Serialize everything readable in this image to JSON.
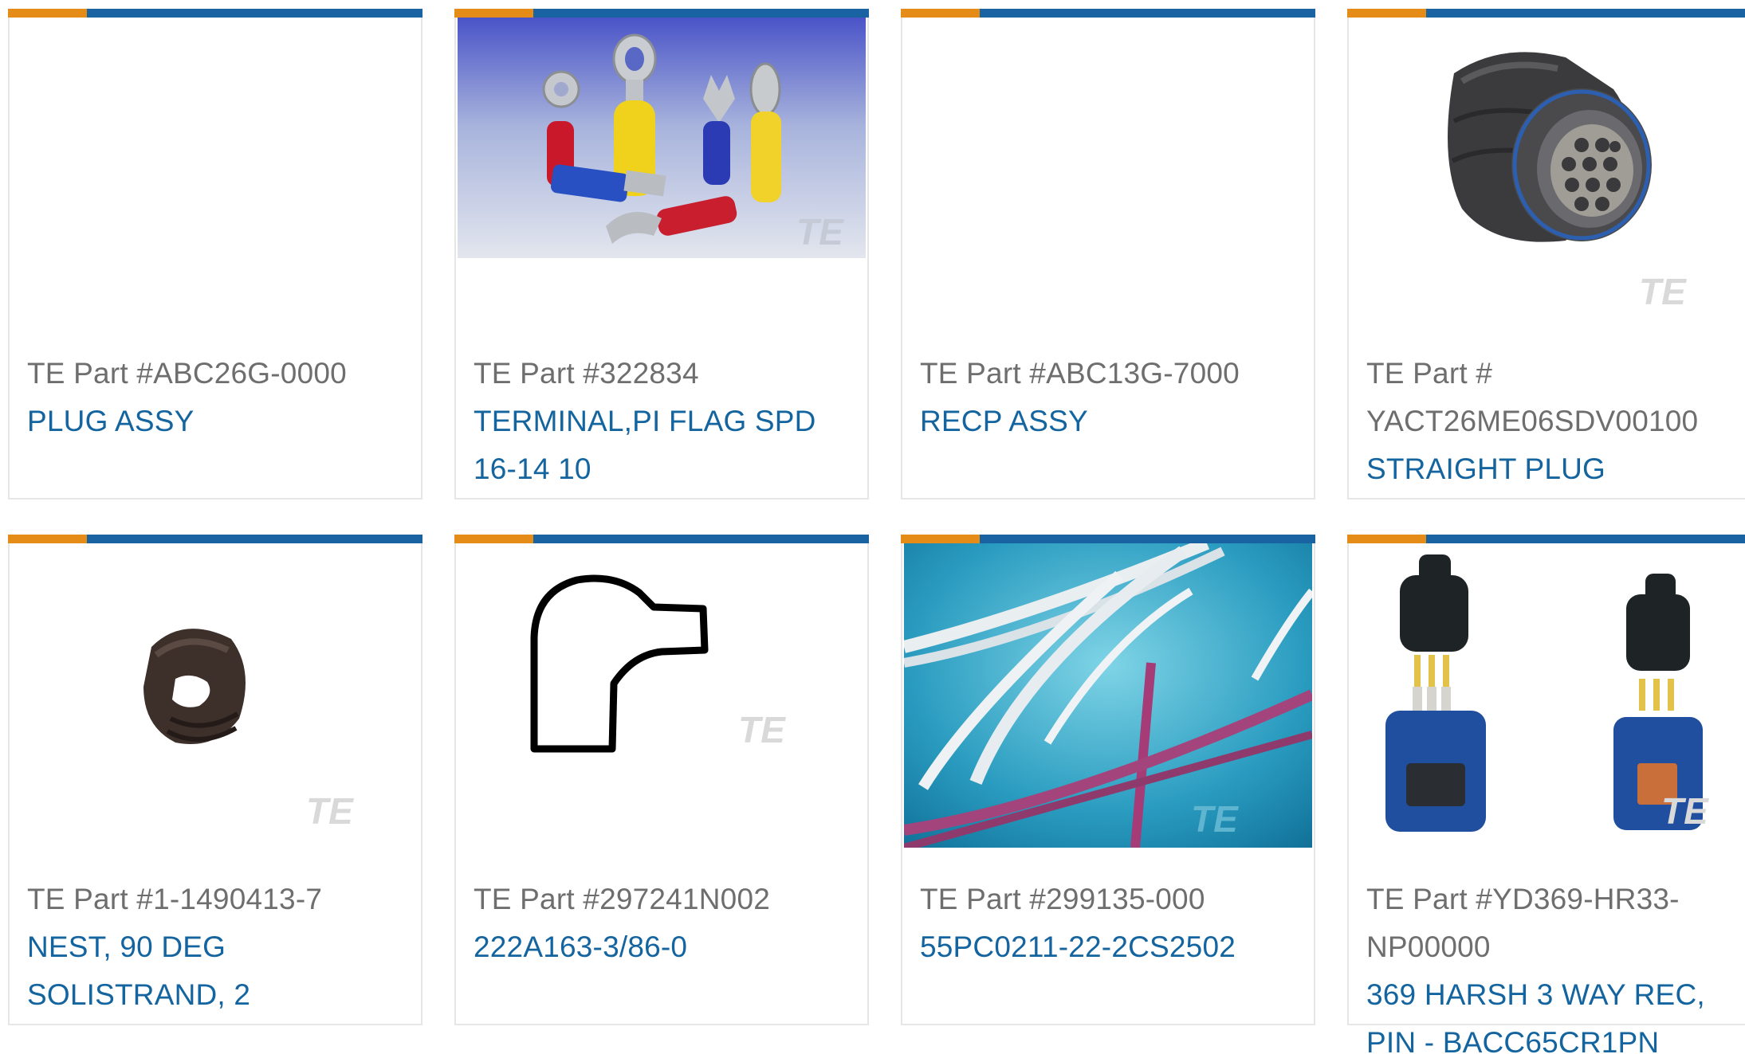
{
  "cards": [
    {
      "part": "TE Part #ABC26G-0000",
      "desc": "PLUG ASSY",
      "image": "none"
    },
    {
      "part": "TE Part #322834",
      "desc": "TERMINAL,PI FLAG SPD 16-14 10",
      "image": "ring-terminals-photo"
    },
    {
      "part": "TE Part #ABC13G-7000",
      "desc": "RECP ASSY",
      "image": "none"
    },
    {
      "part": "TE Part # YACT26ME06SDV00100",
      "desc": "STRAIGHT PLUG",
      "image": "circular-connector-photo"
    },
    {
      "part": "TE Part #1-1490413-7",
      "desc": "NEST, 90 DEG SOLISTRAND, 2",
      "image": "crimp-nest-photo"
    },
    {
      "part": "TE Part #297241N002",
      "desc": "222A163-3/86-0",
      "image": "elbow-boot-drawing"
    },
    {
      "part": "TE Part #299135-000",
      "desc": "55PC0211-22-2CS2502",
      "image": "wires-photo"
    },
    {
      "part": "TE Part #YD369-HR33-NP00000",
      "desc": "369 HARSH 3 WAY REC, PIN - BACC65CR1PN",
      "image": "harsh-connector-photo"
    }
  ],
  "watermark": "TE",
  "colors": {
    "accent_orange": "#e58b17",
    "bar_blue": "#1a63a3",
    "link_blue": "#13649f",
    "part_gray": "#6e6e6e",
    "border": "#e6e6e6"
  }
}
